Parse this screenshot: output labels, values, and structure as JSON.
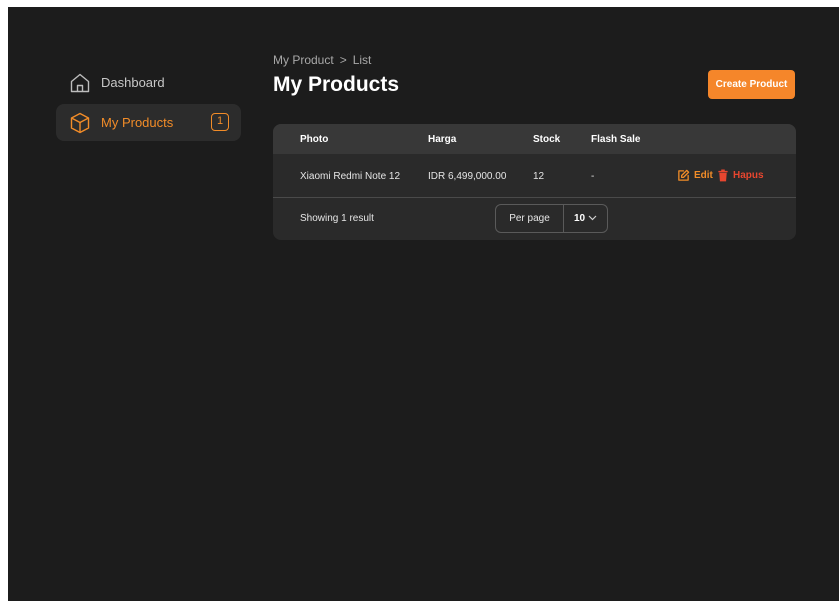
{
  "sidebar": {
    "items": [
      {
        "label": "Dashboard",
        "icon": "home-icon"
      },
      {
        "label": "My Products",
        "icon": "box-icon",
        "badge": "1",
        "active": true
      }
    ]
  },
  "header": {
    "breadcrumb": {
      "parent": "My Product",
      "separator": ">",
      "current": "List"
    },
    "title": "My Products",
    "create_label": "Create Product"
  },
  "table": {
    "columns": [
      "Photo",
      "Harga",
      "Stock",
      "Flash Sale"
    ],
    "rows": [
      {
        "name": "Xiaomi Redmi Note 12",
        "price": "IDR 6,499,000.00",
        "stock": "12",
        "flash_sale": "-",
        "edit_label": "Edit",
        "delete_label": "Hapus"
      }
    ]
  },
  "footer": {
    "result_text": "Showing 1 result",
    "per_page_label": "Per page",
    "per_page_value": "10"
  },
  "colors": {
    "accent": "#f28c28",
    "danger": "#e8462f",
    "background": "#1c1c1c",
    "card": "#2a2a2a"
  }
}
